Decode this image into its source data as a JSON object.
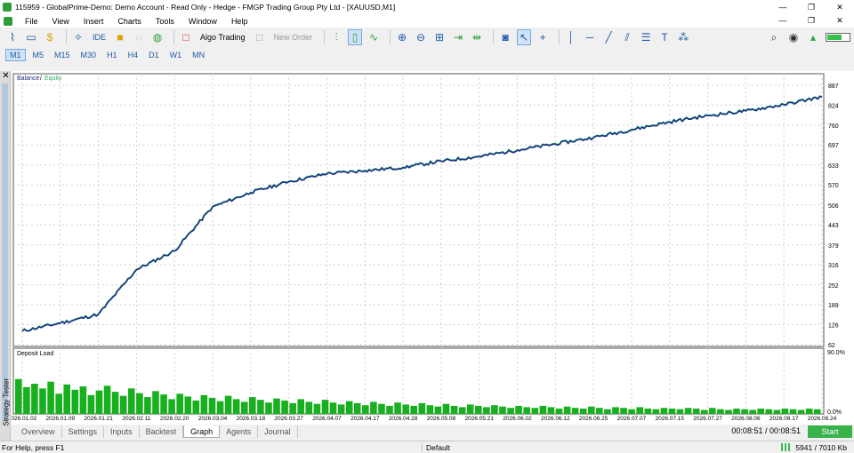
{
  "window": {
    "title": "115959 - GlobalPrime-Demo: Demo Account - Read Only - Hedge - FMGP Trading Group Pty Ltd - [XAUUSD,M1]",
    "controls": [
      "—",
      "❐",
      "✕"
    ]
  },
  "menu": {
    "items": [
      "File",
      "View",
      "Insert",
      "Charts",
      "Tools",
      "Window",
      "Help"
    ],
    "doc_controls": [
      "—",
      "❐",
      "✕"
    ]
  },
  "toolbar": {
    "ide_label": "IDE",
    "algo_trading_label": "Algo Trading",
    "new_order_label": "New Order"
  },
  "timeframes": [
    "M1",
    "M5",
    "M15",
    "M30",
    "H1",
    "H4",
    "D1",
    "W1",
    "MN"
  ],
  "timeframe_active": "M1",
  "side_panel": {
    "label": "Strategy Tester",
    "close": "✕"
  },
  "tabs": [
    "Overview",
    "Settings",
    "Inputs",
    "Backtest",
    "Graph",
    "Agents",
    "Journal"
  ],
  "tab_active": "Graph",
  "tester": {
    "timer": "00:08:51 / 00:08:51",
    "start_label": "Start"
  },
  "status": {
    "help": "For Help, press F1",
    "profile": "Default",
    "connection": "5941 / 7010 Kb"
  },
  "colors": {
    "balance": "#1b2e8a",
    "equity": "#2ca86a",
    "deposit_load": "#19b01f",
    "start": "#38b24a"
  },
  "chart_data": [
    {
      "type": "line",
      "legend": [
        "Balance",
        "Equity"
      ],
      "yticks": [
        62,
        126,
        189,
        252,
        316,
        379,
        443,
        506,
        570,
        633,
        697,
        760,
        824,
        887
      ],
      "ylim": [
        62,
        887
      ],
      "x": [
        "2026.01.02",
        "2026.01.09",
        "2026.01.21",
        "2026.02.11",
        "2026.02.20",
        "2026.03.04",
        "2026.03.18",
        "2026.03.27",
        "2026.04.07",
        "2026.04.17",
        "2026.04.28",
        "2026.05.08",
        "2026.05.21",
        "2026.06.02",
        "2026.06.12",
        "2026.06.25",
        "2026.07.07",
        "2026.07.15",
        "2026.07.27",
        "2026.08.06",
        "2026.08.17",
        "2026.08.24"
      ],
      "series": [
        {
          "name": "Balance",
          "values": [
            105,
            130,
            158,
            300,
            360,
            500,
            545,
            580,
            605,
            615,
            625,
            645,
            660,
            680,
            700,
            720,
            745,
            770,
            790,
            805,
            825,
            850
          ]
        },
        {
          "name": "Equity",
          "values": [
            106,
            131,
            159,
            301,
            361,
            501,
            546,
            581,
            606,
            616,
            626,
            646,
            661,
            681,
            701,
            721,
            746,
            771,
            791,
            806,
            826,
            851
          ]
        }
      ]
    },
    {
      "type": "bar",
      "title": "Deposit Load",
      "yticks": [
        "90.0%",
        "0.0%"
      ],
      "ylim": [
        0,
        90
      ],
      "values": [
        52,
        40,
        45,
        38,
        48,
        30,
        44,
        36,
        41,
        28,
        35,
        42,
        33,
        27,
        38,
        31,
        25,
        34,
        29,
        22,
        30,
        26,
        20,
        28,
        24,
        19,
        27,
        22,
        18,
        25,
        21,
        17,
        23,
        20,
        16,
        22,
        18,
        15,
        21,
        17,
        14,
        19,
        16,
        13,
        18,
        15,
        12,
        17,
        14,
        12,
        16,
        13,
        11,
        15,
        12,
        10,
        14,
        12,
        10,
        13,
        11,
        9,
        12,
        10,
        9,
        12,
        10,
        8,
        11,
        9,
        8,
        11,
        9,
        7,
        10,
        9,
        7,
        10,
        8,
        7,
        9,
        8,
        7,
        9,
        8,
        6,
        9,
        7,
        6,
        8,
        7,
        6,
        8,
        7,
        6,
        8,
        7,
        6,
        8,
        7
      ]
    }
  ]
}
